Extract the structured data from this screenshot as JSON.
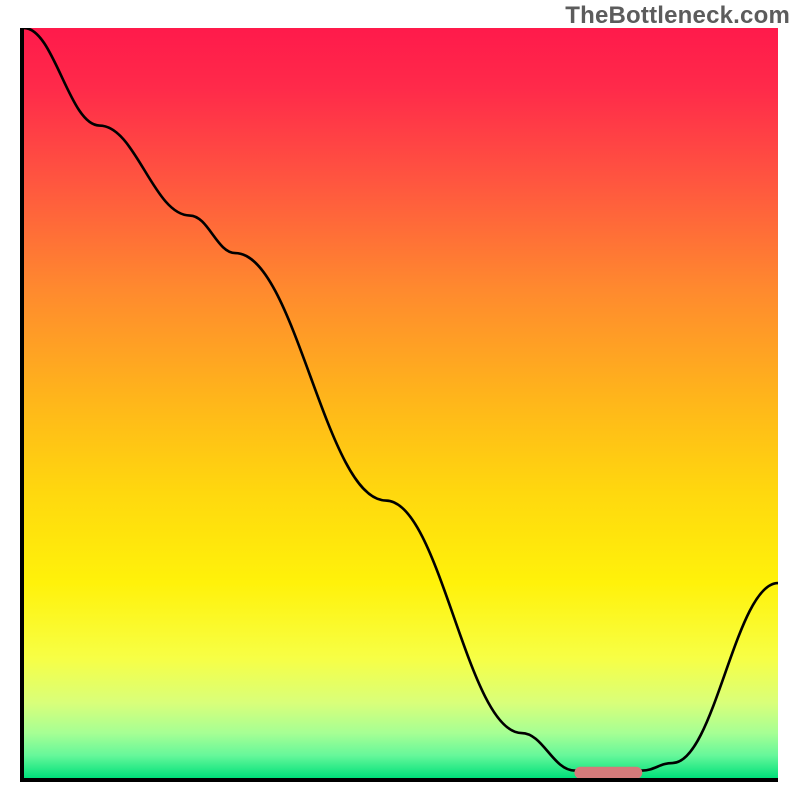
{
  "watermark": "TheBottleneck.com",
  "chart_data": {
    "type": "line",
    "title": "",
    "xlabel": "",
    "ylabel": "",
    "xlim": [
      0,
      100
    ],
    "ylim": [
      0,
      100
    ],
    "gradient_stops": [
      {
        "offset": 0.0,
        "color": "#ff1a4b"
      },
      {
        "offset": 0.08,
        "color": "#ff2a4a"
      },
      {
        "offset": 0.2,
        "color": "#ff5440"
      },
      {
        "offset": 0.35,
        "color": "#ff8a2e"
      },
      {
        "offset": 0.5,
        "color": "#ffb71a"
      },
      {
        "offset": 0.62,
        "color": "#ffd80e"
      },
      {
        "offset": 0.74,
        "color": "#fff20a"
      },
      {
        "offset": 0.84,
        "color": "#f7ff45"
      },
      {
        "offset": 0.9,
        "color": "#d9ff7a"
      },
      {
        "offset": 0.94,
        "color": "#a6ff94"
      },
      {
        "offset": 0.97,
        "color": "#66f79a"
      },
      {
        "offset": 1.0,
        "color": "#00e07a"
      }
    ],
    "series": [
      {
        "name": "bottleneck-curve",
        "x": [
          0,
          10,
          22,
          28,
          48,
          66,
          73,
          82,
          86,
          100
        ],
        "y": [
          100,
          87,
          75,
          70,
          37,
          6,
          1,
          1,
          2,
          26
        ]
      }
    ],
    "marker": {
      "name": "optimal-range",
      "shape": "rounded-bar",
      "x_start": 73,
      "x_end": 82,
      "y": 0.5,
      "color": "#d47a7a"
    }
  }
}
